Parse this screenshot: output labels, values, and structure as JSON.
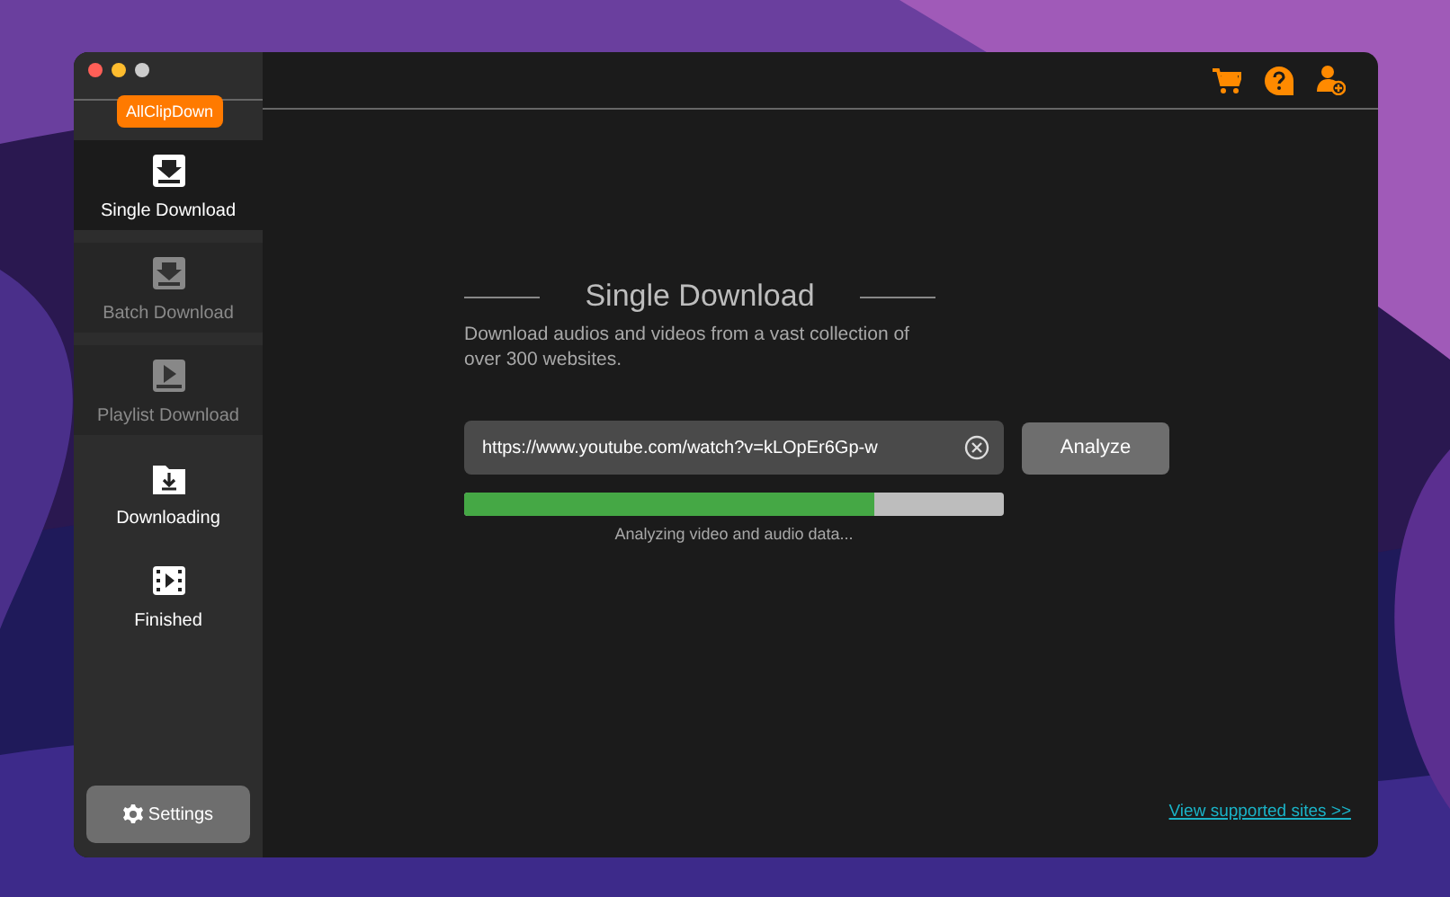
{
  "window": {
    "logo": "AllClipDown"
  },
  "sidebar": {
    "items": [
      {
        "label": "Single Download",
        "selected": true,
        "disabled": false
      },
      {
        "label": "Batch Download",
        "selected": false,
        "disabled": true
      },
      {
        "label": "Playlist Download",
        "selected": false,
        "disabled": true
      },
      {
        "label": "Downloading",
        "selected": false,
        "disabled": false
      },
      {
        "label": "Finished",
        "selected": false,
        "disabled": false
      }
    ],
    "settings_button": "Settings"
  },
  "main": {
    "title": "Single Download",
    "description": "Download audios and videos from a vast collection of over 300 websites.",
    "url_field": {
      "value": "https://www.youtube.com/watch?v=kLOpEr6Gp-w"
    },
    "analyze_button": "Analyze",
    "progress": {
      "level": 0.76,
      "status": "Analyzing video and audio data..."
    },
    "link": "View supported sites >>"
  }
}
